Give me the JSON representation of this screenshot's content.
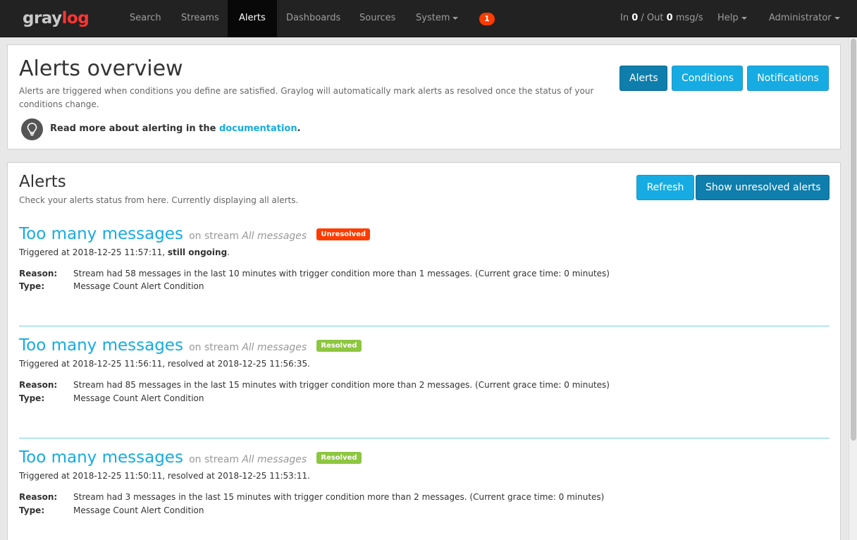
{
  "nav": {
    "logo_gray": "gray",
    "logo_log": "log",
    "items": [
      {
        "label": "Search"
      },
      {
        "label": "Streams"
      },
      {
        "label": "Alerts"
      },
      {
        "label": "Dashboards"
      },
      {
        "label": "Sources"
      },
      {
        "label": "System"
      }
    ],
    "notification_count": "1",
    "throughput": {
      "in_label": "In",
      "in_value": "0",
      "sep": "/ Out",
      "out_value": "0",
      "unit": "msg/s"
    },
    "help": "Help",
    "user": "Administrator"
  },
  "overview": {
    "title": "Alerts overview",
    "description": "Alerts are triggered when conditions you define are satisfied. Graylog will automatically mark alerts as resolved once the status of your conditions change.",
    "readmore_prefix": "Read more about alerting in the",
    "readmore_link": "documentation",
    "readmore_suffix": ".",
    "buttons": {
      "alerts": "Alerts",
      "conditions": "Conditions",
      "notifications": "Notifications"
    }
  },
  "alerts_section": {
    "title": "Alerts",
    "description": "Check your alerts status from here. Currently displaying all alerts.",
    "refresh": "Refresh",
    "show_unresolved": "Show unresolved alerts",
    "reason_label": "Reason:",
    "type_label": "Type:",
    "items": [
      {
        "title": "Too many messages",
        "on_stream": "on stream",
        "stream": "All messages",
        "status": "Unresolved",
        "triggered": "Triggered at 2018-12-25 11:57:11,",
        "ongoing": "still ongoing",
        "ongoing_suffix": ".",
        "reason": "Stream had 58 messages in the last 10 minutes with trigger condition more than 1 messages. (Current grace time: 0 minutes)",
        "type": "Message Count Alert Condition"
      },
      {
        "title": "Too many messages",
        "on_stream": "on stream",
        "stream": "All messages",
        "status": "Resolved",
        "triggered": "Triggered at 2018-12-25 11:56:11, resolved at 2018-12-25 11:56:35.",
        "reason": "Stream had 85 messages in the last 15 minutes with trigger condition more than 2 messages. (Current grace time: 0 minutes)",
        "type": "Message Count Alert Condition"
      },
      {
        "title": "Too many messages",
        "on_stream": "on stream",
        "stream": "All messages",
        "status": "Resolved",
        "triggered": "Triggered at 2018-12-25 11:50:11, resolved at 2018-12-25 11:53:11.",
        "reason": "Stream had 3 messages in the last 15 minutes with trigger condition more than 2 messages. (Current grace time: 0 minutes)",
        "type": "Message Count Alert Condition"
      }
    ]
  },
  "colors": {
    "accent": "#16ace3",
    "unresolved": "#ff3b00",
    "resolved": "#8dc63f",
    "navbar": "#222222"
  }
}
